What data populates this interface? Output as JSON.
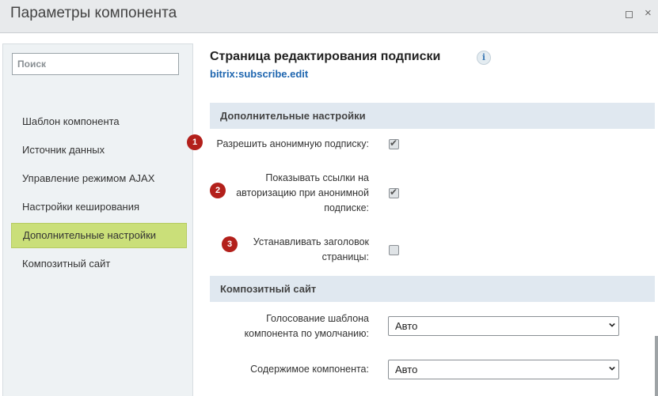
{
  "window": {
    "title": "Параметры компонента",
    "max_icon": "maximize-icon",
    "close_icon": "close-icon",
    "close_glyph": "×"
  },
  "sidebar": {
    "search_placeholder": "Поиск",
    "items": [
      {
        "label": "Шаблон компонента"
      },
      {
        "label": "Источник данных"
      },
      {
        "label": "Управление режимом AJAX"
      },
      {
        "label": "Настройки кеширования"
      },
      {
        "label": "Дополнительные настройки",
        "active": true
      },
      {
        "label": "Композитный сайт"
      }
    ]
  },
  "component": {
    "title": "Страница редактирования подписки",
    "code": "bitrix:subscribe.edit",
    "info_glyph": "i"
  },
  "sections": {
    "additional": {
      "title": "Дополнительные настройки",
      "rows": [
        {
          "badge": "1",
          "label_lines": [
            "Разрешить анонимную подписку:"
          ],
          "checked": true
        },
        {
          "badge": "2",
          "label_lines": [
            "Показывать ссылки на",
            "авторизацию при анонимной",
            "подписке:"
          ],
          "checked": true
        },
        {
          "badge": "3",
          "label_lines": [
            "Устанавливать заголовок",
            "страницы:"
          ],
          "checked": false
        }
      ]
    },
    "composite": {
      "title": "Композитный сайт",
      "rows": [
        {
          "label_lines": [
            "Голосование шаблона",
            "компонента по умолчанию:"
          ],
          "value": "Авто"
        },
        {
          "label_lines": [
            "Содержимое компонента:"
          ],
          "value": "Авто"
        }
      ]
    }
  },
  "colors": {
    "active_item": "#cadf79",
    "section_header": "#e0e8f0",
    "badge": "#b3201b",
    "link": "#2067b0"
  },
  "check_glyph": "✔"
}
